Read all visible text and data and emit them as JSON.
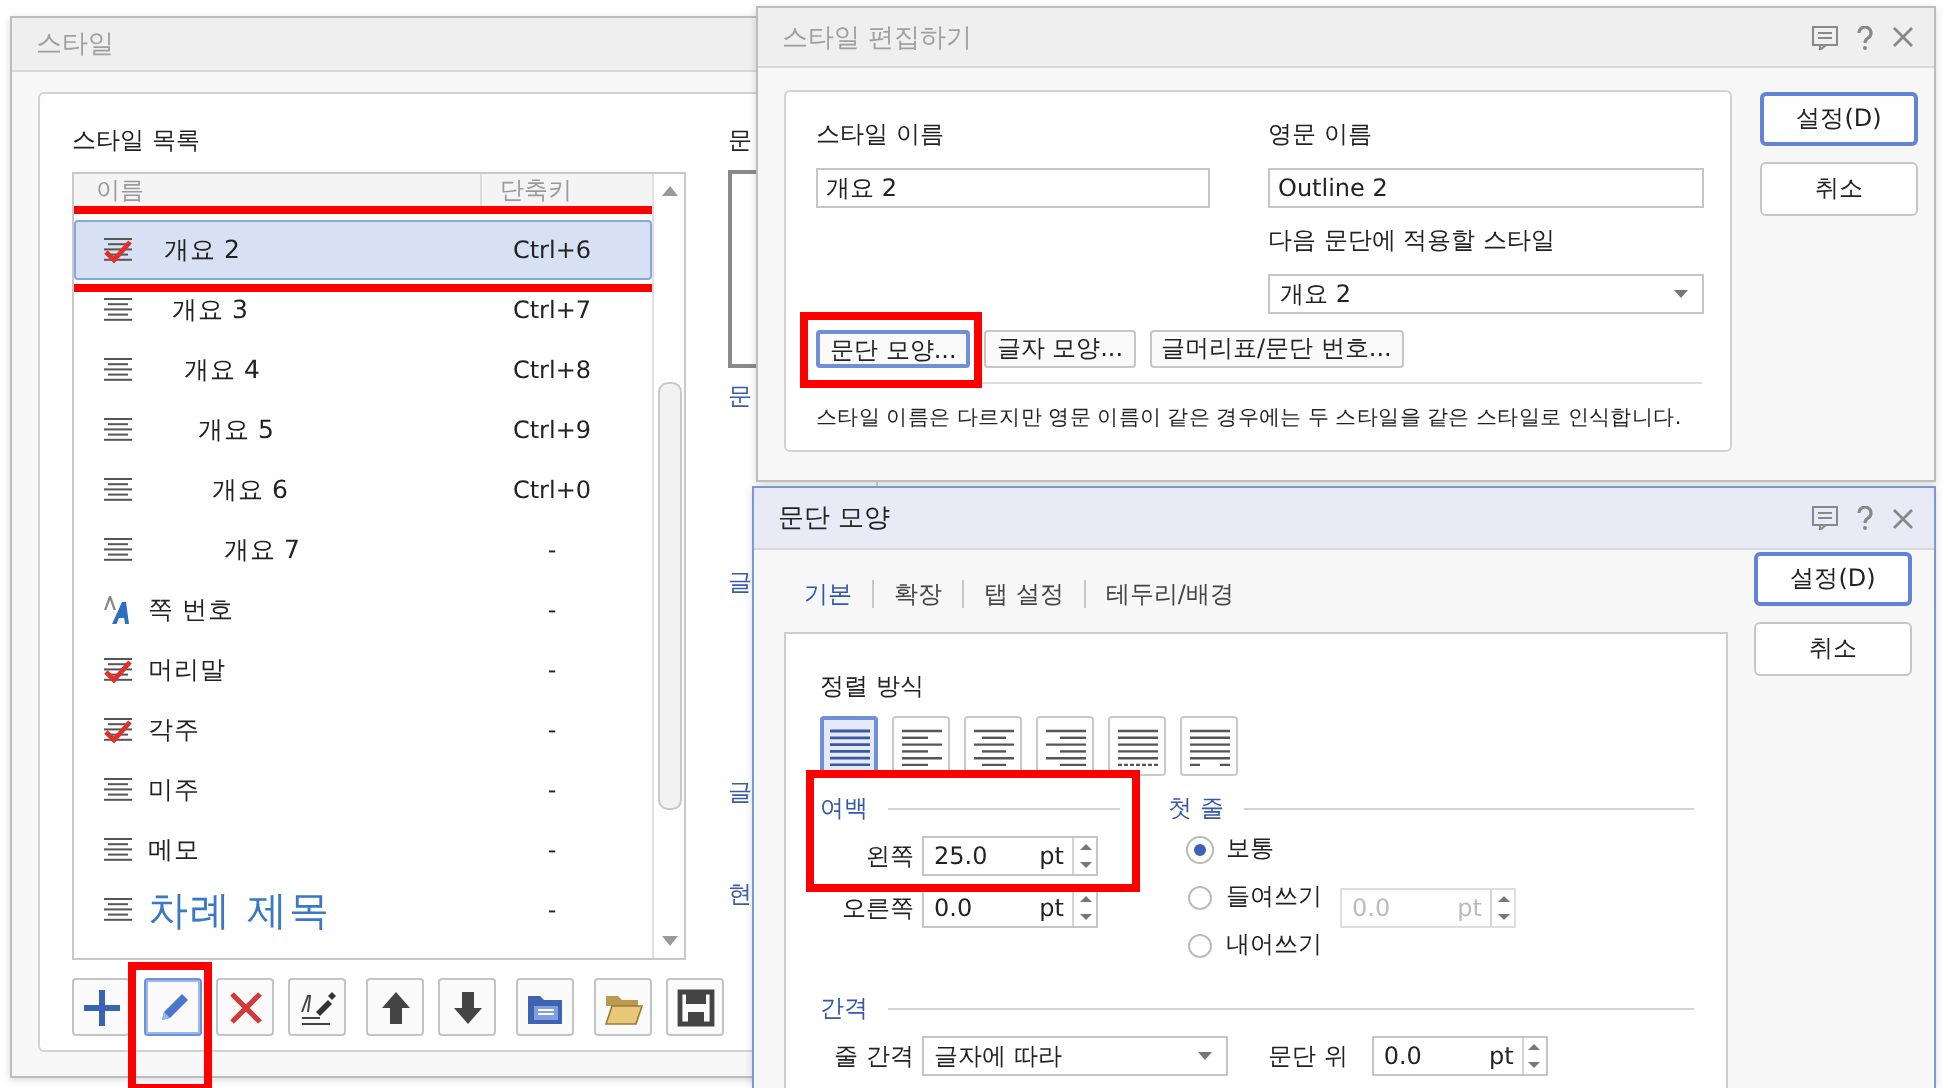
{
  "style_dialog": {
    "title": "스타일",
    "list_label": "스타일 목록",
    "columns": [
      "이름",
      "단축키"
    ],
    "items": [
      {
        "name": "개요 2",
        "shortcut": "Ctrl+6",
        "kind": "outline-2",
        "checked": true,
        "selected": true,
        "highlighted": true
      },
      {
        "name": "개요 3",
        "shortcut": "Ctrl+7",
        "kind": "outline-3",
        "checked": false,
        "selected": false,
        "highlighted": false
      },
      {
        "name": "개요 4",
        "shortcut": "Ctrl+8",
        "kind": "outline-4",
        "checked": false,
        "selected": false,
        "highlighted": false
      },
      {
        "name": "개요 5",
        "shortcut": "Ctrl+9",
        "kind": "outline-5",
        "checked": false,
        "selected": false,
        "highlighted": false
      },
      {
        "name": "개요 6",
        "shortcut": "Ctrl+0",
        "kind": "outline-6",
        "checked": false,
        "selected": false,
        "highlighted": false
      },
      {
        "name": "개요 7",
        "shortcut": "-",
        "kind": "outline-7",
        "checked": false,
        "selected": false,
        "highlighted": false
      },
      {
        "name": "쪽 번호",
        "shortcut": "-",
        "kind": "character",
        "checked": false,
        "selected": false,
        "highlighted": false
      },
      {
        "name": "머리말",
        "shortcut": "-",
        "kind": "paragraph",
        "checked": true,
        "selected": false,
        "highlighted": false
      },
      {
        "name": "각주",
        "shortcut": "-",
        "kind": "paragraph",
        "checked": true,
        "selected": false,
        "highlighted": false
      },
      {
        "name": "미주",
        "shortcut": "-",
        "kind": "paragraph",
        "checked": false,
        "selected": false,
        "highlighted": false
      },
      {
        "name": "메모",
        "shortcut": "-",
        "kind": "paragraph",
        "checked": false,
        "selected": false,
        "highlighted": false
      },
      {
        "name": "차례 제목",
        "shortcut": "-",
        "kind": "toc-title",
        "checked": false,
        "selected": false,
        "highlighted": false
      }
    ],
    "toolbar": [
      {
        "kind": "add",
        "highlighted": false
      },
      {
        "kind": "edit",
        "highlighted": true
      },
      {
        "kind": "delete",
        "highlighted": false
      },
      {
        "kind": "pick",
        "highlighted": false
      },
      {
        "kind": "up",
        "highlighted": false
      },
      {
        "kind": "down",
        "highlighted": false
      },
      {
        "kind": "import",
        "highlighted": false
      },
      {
        "kind": "open",
        "highlighted": false
      },
      {
        "kind": "save",
        "highlighted": false
      }
    ],
    "side_labels": [
      {
        "text": "문",
        "kind": "heading"
      },
      {
        "text": "문",
        "kind": "section"
      },
      {
        "text": "글",
        "kind": "section"
      },
      {
        "text": "글",
        "kind": "section"
      },
      {
        "text": "현",
        "kind": "section"
      }
    ]
  },
  "edit_dialog": {
    "title": "스타일 편집하기",
    "style_name": {
      "label": "스타일 이름",
      "value": "개요 2"
    },
    "english_name": {
      "label": "영문 이름",
      "value": "Outline 2"
    },
    "next_style": {
      "label": "다음 문단에 적용할 스타일",
      "value": "개요 2"
    },
    "format_buttons": [
      {
        "label": "문단 모양...",
        "highlighted": true
      },
      {
        "label": "글자 모양...",
        "highlighted": false
      },
      {
        "label": "글머리표/문단 번호...",
        "highlighted": false
      }
    ],
    "note": "스타일 이름은 다르지만 영문 이름이 같은 경우에는 두 스타일을 같은 스타일로 인식합니다.",
    "buttons": [
      {
        "label": "설정(D)",
        "default": true
      },
      {
        "label": "취소",
        "default": false
      }
    ]
  },
  "para_dialog": {
    "title": "문단 모양",
    "tabs": [
      {
        "label": "기본",
        "selected": true
      },
      {
        "label": "확장",
        "selected": false
      },
      {
        "label": "탭 설정",
        "selected": false
      },
      {
        "label": "테두리/배경",
        "selected": false
      }
    ],
    "alignment": {
      "label": "정렬 방식",
      "options": [
        {
          "kind": "justify",
          "selected": true
        },
        {
          "kind": "left",
          "selected": false
        },
        {
          "kind": "center",
          "selected": false
        },
        {
          "kind": "right",
          "selected": false
        },
        {
          "kind": "distribute",
          "selected": false
        },
        {
          "kind": "divide",
          "selected": false
        }
      ]
    },
    "margin": {
      "label": "여백",
      "highlighted": true,
      "fields": [
        {
          "label": "왼쪽",
          "value": "25.0",
          "unit": "pt"
        },
        {
          "label": "오른쪽",
          "value": "0.0",
          "unit": "pt"
        }
      ]
    },
    "first_line": {
      "label": "첫 줄",
      "options": [
        {
          "label": "보통",
          "selected": true
        },
        {
          "label": "들여쓰기",
          "selected": false
        },
        {
          "label": "내어쓰기",
          "selected": false
        }
      ],
      "field": {
        "value": "0.0",
        "unit": "pt",
        "disabled": true
      }
    },
    "spacing": {
      "label": "간격",
      "line_spacing": {
        "label": "줄 간격",
        "value": "글자에 따라"
      },
      "above": {
        "label": "문단 위",
        "value": "0.0",
        "unit": "pt"
      }
    },
    "buttons": [
      {
        "label": "설정(D)",
        "default": true
      },
      {
        "label": "취소",
        "default": false
      }
    ]
  }
}
